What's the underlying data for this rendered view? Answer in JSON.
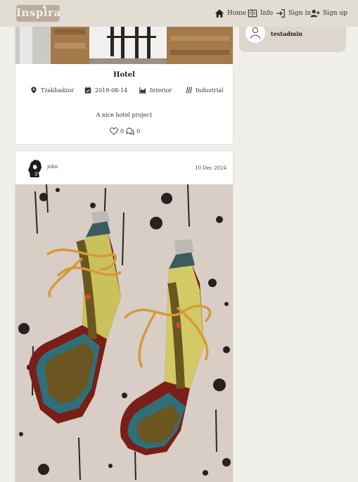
{
  "brand": {
    "logo_text": "Inspira"
  },
  "nav": {
    "home": "Home",
    "info": "Info",
    "sign_in": "Sign in",
    "sign_up": "Sign up"
  },
  "sidebar": {
    "username": "testadmin"
  },
  "project_card": {
    "title": "Hotel",
    "location": "Tzakhadzor",
    "date": "2019-08-14",
    "category": "Interior",
    "style": "Industrial",
    "description": "A nice hotel project",
    "likes": "0",
    "comments": "0"
  },
  "post_card": {
    "author": "john",
    "date": "10 Dec 2024"
  },
  "colors": {
    "topbar": "#e2ddd3",
    "logo_bg": "#b9ad9b",
    "page_bg": "#f1efea",
    "user_card_bg": "#dcd6cc"
  },
  "icons": [
    "home-icon",
    "info-icon",
    "sign-in-icon",
    "sign-up-icon",
    "user-icon",
    "location-icon",
    "calendar-icon",
    "chart-icon",
    "style-icon",
    "heart-icon",
    "comment-icon"
  ]
}
